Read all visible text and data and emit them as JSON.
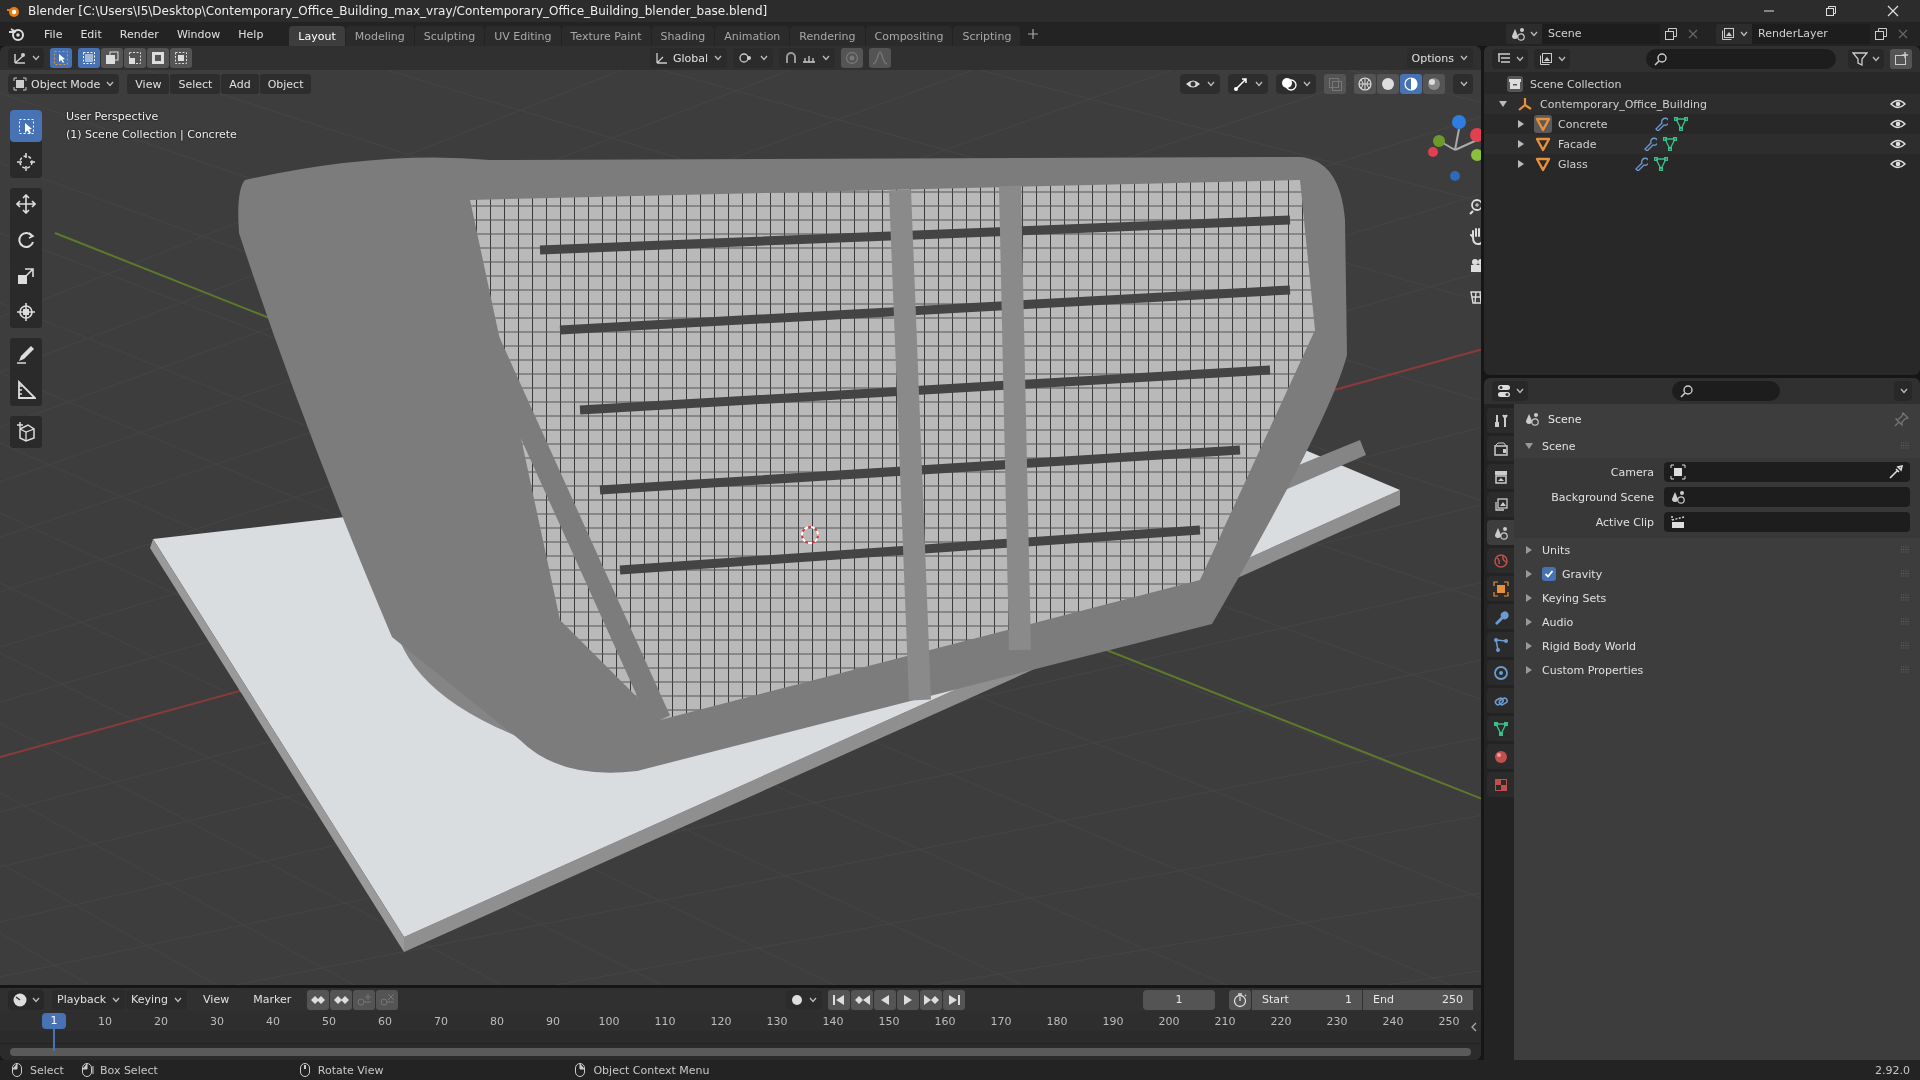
{
  "window": {
    "title": "Blender [C:\\Users\\I5\\Desktop\\Contemporary_Office_Building_max_vray/Contemporary_Office_Building_blender_base.blend]"
  },
  "menu": [
    "File",
    "Edit",
    "Render",
    "Window",
    "Help"
  ],
  "workspaces": [
    {
      "label": "Layout",
      "selected": true
    },
    {
      "label": "Modeling",
      "selected": false
    },
    {
      "label": "Sculpting",
      "selected": false
    },
    {
      "label": "UV Editing",
      "selected": false
    },
    {
      "label": "Texture Paint",
      "selected": false
    },
    {
      "label": "Shading",
      "selected": false
    },
    {
      "label": "Animation",
      "selected": false
    },
    {
      "label": "Rendering",
      "selected": false
    },
    {
      "label": "Compositing",
      "selected": false
    },
    {
      "label": "Scripting",
      "selected": false
    }
  ],
  "scene_selector": {
    "scene": "Scene",
    "view_layer": "RenderLayer"
  },
  "viewport_header": {
    "orientation": "Global",
    "options": "Options",
    "select_modes": [
      {
        "selected": true
      },
      {
        "selected": false
      },
      {
        "selected": false
      },
      {
        "selected": false
      },
      {
        "selected": false
      }
    ]
  },
  "viewport": {
    "mode": "Object Mode",
    "menus": [
      "View",
      "Select",
      "Add",
      "Object"
    ],
    "info": [
      "User Perspective",
      "(1) Scene Collection | Concrete"
    ],
    "tool_groups": [
      [
        {
          "kind": "select",
          "selected": true
        },
        {
          "kind": "cursor",
          "selected": false
        }
      ],
      [
        {
          "kind": "move",
          "selected": false
        },
        {
          "kind": "rotate",
          "selected": false
        },
        {
          "kind": "scale",
          "selected": false
        },
        {
          "kind": "transform",
          "selected": false
        }
      ],
      [
        {
          "kind": "annotate",
          "selected": false
        },
        {
          "kind": "measure",
          "selected": false
        }
      ],
      [
        {
          "kind": "add_cube",
          "selected": false
        }
      ]
    ],
    "shading": [
      {
        "kind": "wireframe",
        "selected": false
      },
      {
        "kind": "solid",
        "selected": false
      },
      {
        "kind": "material",
        "selected": true
      },
      {
        "kind": "rendered",
        "selected": false
      }
    ]
  },
  "outliner": {
    "root": "Scene Collection",
    "items": [
      {
        "label": "Contemporary_Office_Building",
        "kind": "empty",
        "expanded": true,
        "selected": false,
        "children": [
          {
            "label": "Concrete",
            "kind": "mesh",
            "expanded": false,
            "selected": true
          },
          {
            "label": "Facade",
            "kind": "mesh",
            "expanded": false,
            "selected": false
          },
          {
            "label": "Glass",
            "kind": "mesh",
            "expanded": false,
            "selected": false
          }
        ]
      }
    ]
  },
  "properties": {
    "tabs": [
      {
        "kind": "tool",
        "selected": false
      },
      {
        "kind": "render",
        "selected": false
      },
      {
        "kind": "output",
        "selected": false
      },
      {
        "kind": "view_layer",
        "selected": false
      },
      {
        "kind": "scene",
        "selected": true
      },
      {
        "kind": "world",
        "selected": false
      },
      {
        "kind": "object",
        "selected": false
      },
      {
        "kind": "modifiers",
        "selected": false
      },
      {
        "kind": "particles",
        "selected": false
      },
      {
        "kind": "physics",
        "selected": false
      },
      {
        "kind": "constraints",
        "selected": false
      },
      {
        "kind": "data",
        "selected": false
      },
      {
        "kind": "material",
        "selected": false
      },
      {
        "kind": "texture",
        "selected": false
      }
    ],
    "context": "Scene",
    "panel": {
      "title": "Scene",
      "expanded": true,
      "fields": [
        {
          "label": "Camera",
          "kind": "camera"
        },
        {
          "label": "Background Scene",
          "kind": "scene"
        },
        {
          "label": "Active Clip",
          "kind": "clip"
        }
      ]
    },
    "subpanels": [
      {
        "label": "Units",
        "kind": "panel",
        "expanded": false
      },
      {
        "label": "Gravity",
        "kind": "checkbox",
        "checked": true,
        "expanded": false
      },
      {
        "label": "Keying Sets",
        "kind": "panel",
        "expanded": false
      },
      {
        "label": "Audio",
        "kind": "panel",
        "expanded": false
      },
      {
        "label": "Rigid Body World",
        "kind": "panel",
        "expanded": false
      },
      {
        "label": "Custom Properties",
        "kind": "panel",
        "expanded": false
      }
    ]
  },
  "timeline": {
    "menus": [
      "Playback",
      "Keying"
    ],
    "items": [
      "View",
      "Marker"
    ],
    "current_frame": "1",
    "start_label": "Start",
    "start": "1",
    "end_label": "End",
    "end": "250",
    "playhead": "1",
    "ticks": [
      "10",
      "20",
      "30",
      "40",
      "50",
      "60",
      "70",
      "80",
      "90",
      "100",
      "110",
      "120",
      "130",
      "140",
      "150",
      "160",
      "170",
      "180",
      "190",
      "200",
      "210",
      "220",
      "230",
      "240",
      "250"
    ]
  },
  "status_bar": {
    "hints": [
      {
        "label": "Select",
        "kind": "left"
      },
      {
        "label": "Box Select",
        "kind": "drag"
      },
      {
        "label": "Rotate View",
        "kind": "middle"
      },
      {
        "label": "Object Context Menu",
        "kind": "right"
      }
    ],
    "version": "2.92.0"
  }
}
